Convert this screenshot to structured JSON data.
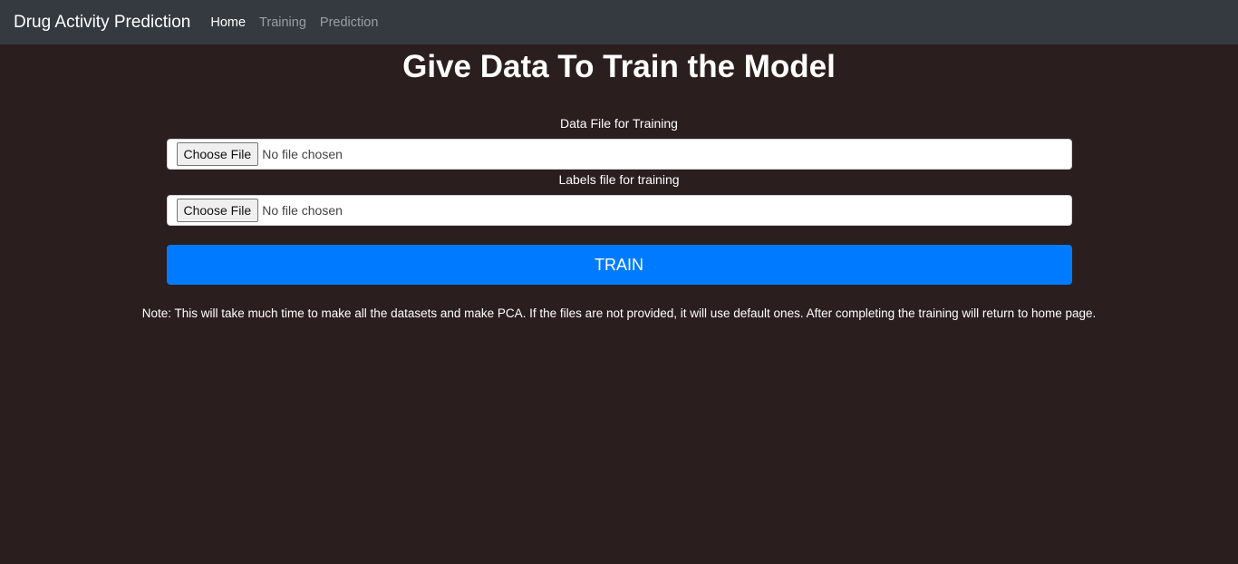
{
  "navbar": {
    "brand": "Drug Activity Prediction",
    "links": [
      {
        "label": "Home",
        "active": true
      },
      {
        "label": "Training",
        "active": false
      },
      {
        "label": "Prediction",
        "active": false
      }
    ]
  },
  "main": {
    "title": "Give Data To Train the Model",
    "data_file": {
      "label": "Data File for Training",
      "button": "Choose File",
      "status": "No file chosen"
    },
    "labels_file": {
      "label": "Labels file for training",
      "button": "Choose File",
      "status": "No file chosen"
    },
    "train_button": "TRAIN",
    "note": "Note: This will take much time to make all the datasets and make PCA. If the files are not provided, it will use default ones. After completing the training will return to home page."
  },
  "colors": {
    "background": "#2b1e1f",
    "navbar": "#343a40",
    "primary": "#007bff"
  }
}
